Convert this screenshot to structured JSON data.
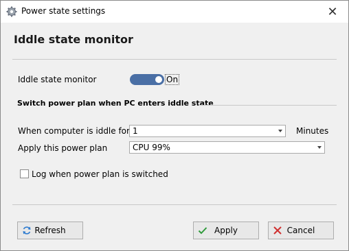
{
  "window": {
    "title": "Power state settings",
    "close_icon": "close-icon",
    "app_icon": "gear-icon"
  },
  "heading": "Iddle state monitor",
  "monitor": {
    "label": "Iddle state monitor",
    "toggle_state": "On",
    "toggle_on": true,
    "accent_color": "#4a6fa5"
  },
  "section": {
    "title": "Switch power plan when PC enters iddle state"
  },
  "idle": {
    "label": "When computer is iddle for",
    "value": "1",
    "unit": "Minutes"
  },
  "plan": {
    "label": "Apply this power plan",
    "value": "CPU 99%"
  },
  "log": {
    "label": "Log when power plan is switched",
    "checked": false
  },
  "buttons": {
    "refresh": "Refresh",
    "apply": "Apply",
    "cancel": "Cancel"
  }
}
